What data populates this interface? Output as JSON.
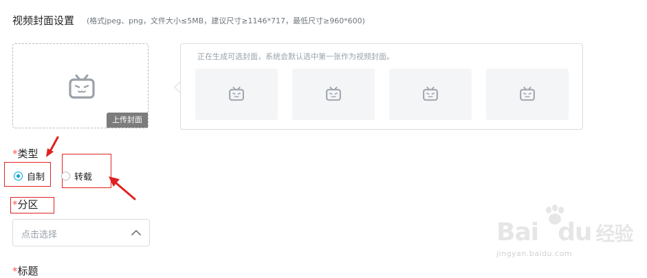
{
  "header": {
    "title": "视频封面设置",
    "hint": "(格式jpeg、png，文件大小≤5MB，建议尺寸≥1146*717，最低尺寸≥960*600)"
  },
  "cover_upload": {
    "badge": "上传封面",
    "icon": "bilibili-tv-icon"
  },
  "auto_covers": {
    "hint": "正在生成可选封面，系统会默认选中第一张作为视频封面。",
    "thumbnails": [
      {
        "icon": "bilibili-tv-icon"
      },
      {
        "icon": "bilibili-tv-icon"
      },
      {
        "icon": "bilibili-tv-icon"
      },
      {
        "icon": "bilibili-tv-icon"
      }
    ]
  },
  "type_field": {
    "star": "*",
    "label": "类型",
    "options": [
      {
        "label": "自制",
        "checked": true
      },
      {
        "label": "转载",
        "checked": false
      }
    ]
  },
  "zone_field": {
    "star": "*",
    "label": "分区",
    "placeholder": "点击选择"
  },
  "title_field": {
    "star": "*",
    "label": "标题"
  },
  "watermark": {
    "brand_text": "Bai",
    "brand_text_2": "du",
    "brand_cn": "经验",
    "url": "jingyan.baidu.com"
  },
  "colors": {
    "accent": "#00a1d6",
    "required_star": "#f45a5a",
    "annotation_red": "#e02020"
  }
}
